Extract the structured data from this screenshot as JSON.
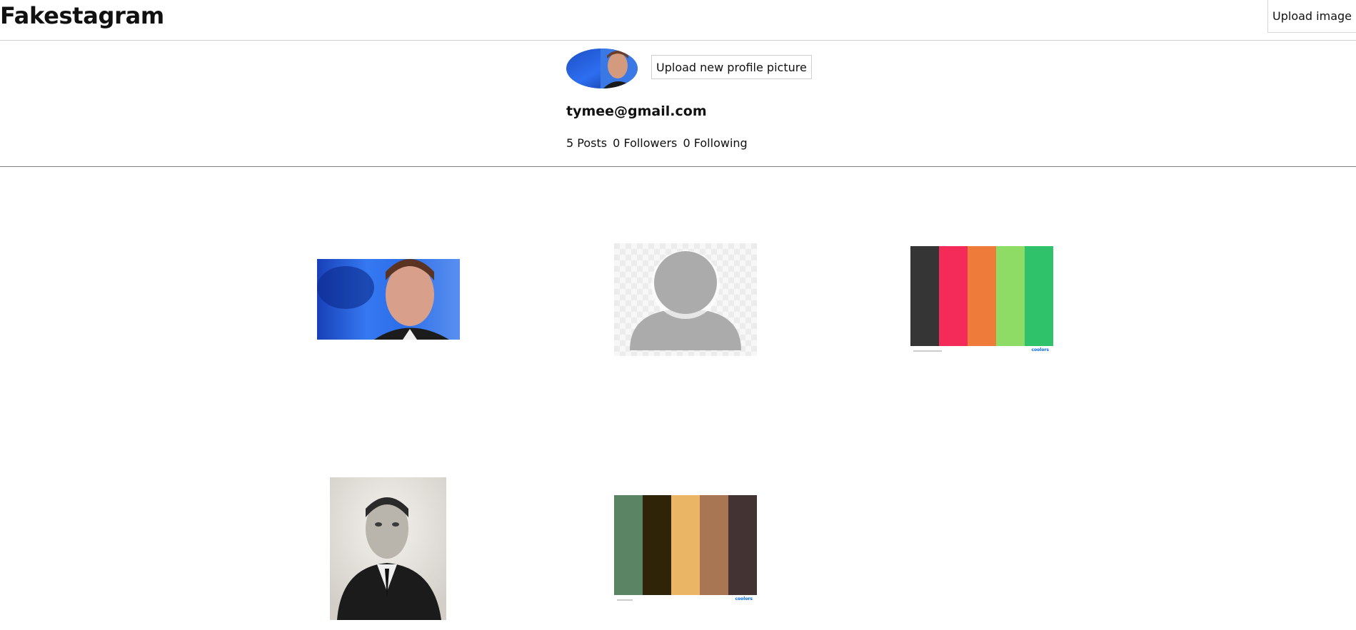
{
  "header": {
    "title": "Fakestagram",
    "upload_image_label": "Upload image"
  },
  "profile": {
    "upload_profile_picture_label": "Upload new profile picture",
    "email": "tymee@gmail.com",
    "stats": {
      "posts": "5 Posts",
      "followers": "0 Followers",
      "following": "0 Following"
    }
  },
  "posts": [
    {
      "kind": "photo",
      "subject": "man portrait blue background"
    },
    {
      "kind": "placeholder",
      "subject": "default avatar"
    },
    {
      "kind": "palette",
      "colors": [
        "#353535",
        "#f42b58",
        "#ef7b3a",
        "#8edb66",
        "#2fc26a"
      ],
      "brand": "coolors"
    },
    {
      "kind": "photo",
      "subject": "black-and-white portrait"
    },
    {
      "kind": "palette",
      "colors": [
        "#5b8465",
        "#2f2408",
        "#eab565",
        "#a87652",
        "#433333"
      ],
      "brand": "coolors"
    }
  ]
}
